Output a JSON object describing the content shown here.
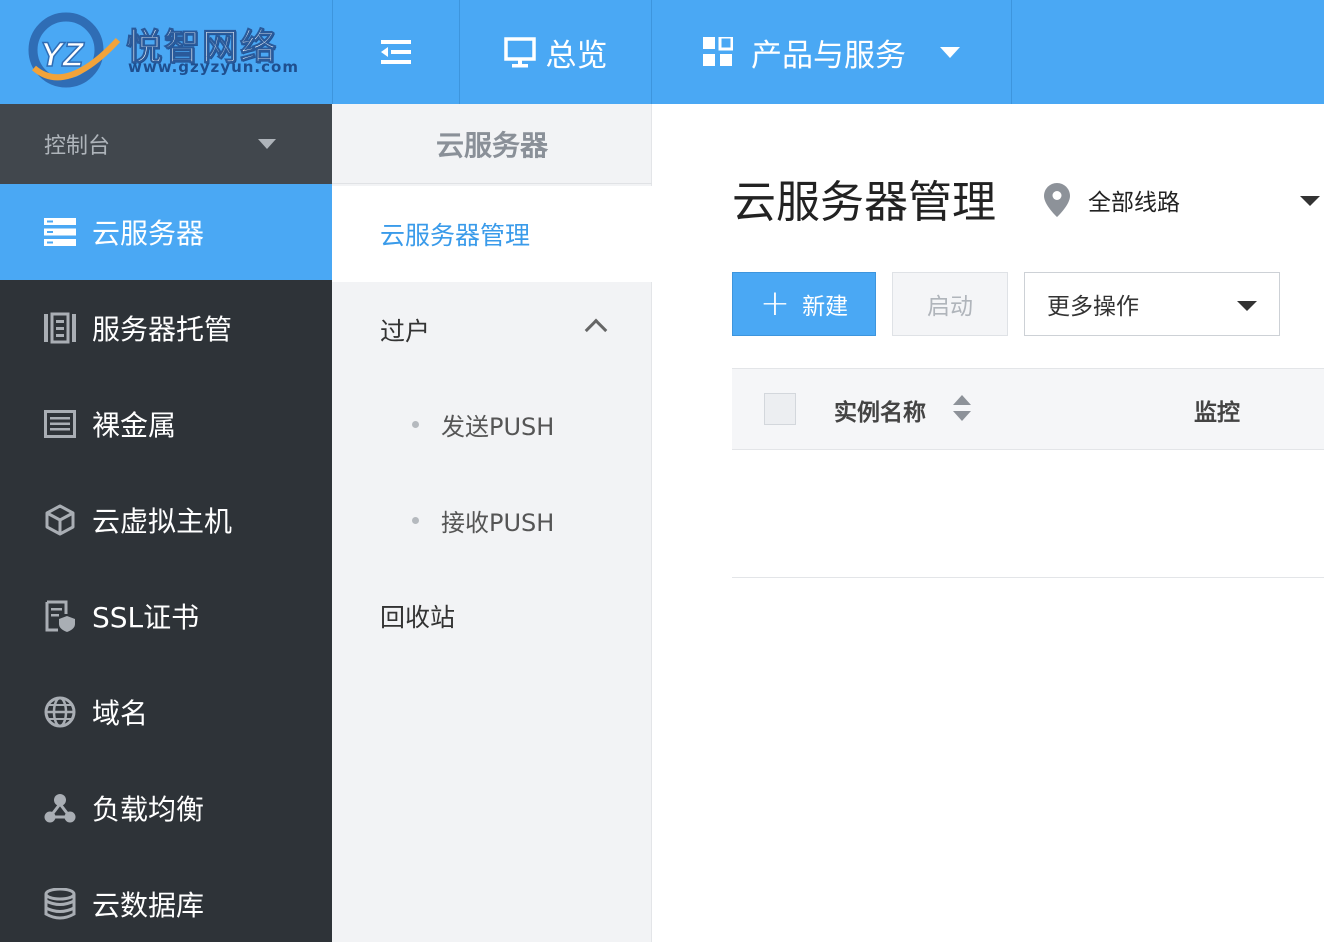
{
  "brand": {
    "name": "悦智网络",
    "url": "www.gzyzyun.com",
    "logo_letters": "YZ",
    "colors": {
      "primary": "#4aa8f4",
      "sidebar": "#2e3338",
      "sidebar_header": "#41474d"
    }
  },
  "topnav": {
    "toggle_icon": "menu-collapse-icon",
    "overview": {
      "label": "总览",
      "icon": "monitor-icon"
    },
    "products": {
      "label": "产品与服务",
      "icon": "grid-icon"
    }
  },
  "sidebar": {
    "console_label": "控制台",
    "items": [
      {
        "label": "云服务器",
        "icon": "server-stack-icon",
        "active": true
      },
      {
        "label": "服务器托管",
        "icon": "rack-icon",
        "active": false
      },
      {
        "label": "裸金属",
        "icon": "list-box-icon",
        "active": false
      },
      {
        "label": "云虚拟主机",
        "icon": "cube-icon",
        "active": false
      },
      {
        "label": "SSL证书",
        "icon": "certificate-icon",
        "active": false
      },
      {
        "label": "域名",
        "icon": "globe-icon",
        "active": false
      },
      {
        "label": "负载均衡",
        "icon": "network-node-icon",
        "active": false
      },
      {
        "label": "云数据库",
        "icon": "database-icon",
        "active": false
      }
    ]
  },
  "subnav": {
    "title": "云服务器",
    "items": {
      "management": "云服务器管理",
      "transfer": "过户",
      "send_push": "发送PUSH",
      "receive_push": "接收PUSH",
      "recycle_bin": "回收站"
    }
  },
  "main": {
    "title": "云服务器管理",
    "region": {
      "label": "全部线路",
      "icon": "location-pin-icon"
    },
    "toolbar": {
      "new_label": "新建",
      "start_label": "启动",
      "more_label": "更多操作"
    },
    "table": {
      "columns": [
        "实例名称",
        "监控"
      ]
    }
  }
}
